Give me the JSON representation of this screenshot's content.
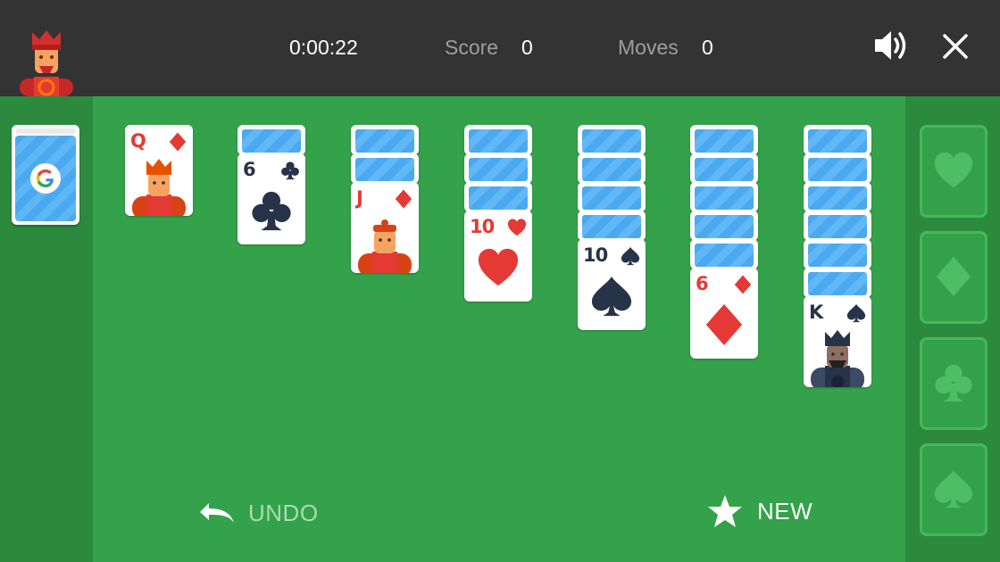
{
  "header": {
    "timer": "0:00:22",
    "score_label": "Score",
    "score_value": "0",
    "moves_label": "Moves",
    "moves_value": "0",
    "sound_icon": "speaker-icon",
    "close_icon": "close-icon"
  },
  "colors": {
    "felt": "#34a24a",
    "side_panel": "#2c8a3f",
    "top_bar": "#333333",
    "red_suit": "#e53935",
    "black_suit": "#263348",
    "card_back": "#4aa9f0"
  },
  "stock": {
    "logo": "G",
    "face_down": true
  },
  "tableau": [
    {
      "face_down_count": 0,
      "top_card": {
        "rank": "Q",
        "suit": "diamonds",
        "color": "red"
      }
    },
    {
      "face_down_count": 1,
      "top_card": {
        "rank": "6",
        "suit": "clubs",
        "color": "black"
      }
    },
    {
      "face_down_count": 2,
      "top_card": {
        "rank": "J",
        "suit": "diamonds",
        "color": "red"
      }
    },
    {
      "face_down_count": 3,
      "top_card": {
        "rank": "10",
        "suit": "hearts",
        "color": "red"
      }
    },
    {
      "face_down_count": 4,
      "top_card": {
        "rank": "10",
        "suit": "spades",
        "color": "black"
      }
    },
    {
      "face_down_count": 5,
      "top_card": {
        "rank": "6",
        "suit": "diamonds",
        "color": "red"
      }
    },
    {
      "face_down_count": 6,
      "top_card": {
        "rank": "K",
        "suit": "spades",
        "color": "black"
      }
    }
  ],
  "foundations": [
    {
      "suit": "hearts",
      "icon": "heart-icon"
    },
    {
      "suit": "diamonds",
      "icon": "diamond-icon"
    },
    {
      "suit": "clubs",
      "icon": "club-icon"
    },
    {
      "suit": "spades",
      "icon": "spade-icon"
    }
  ],
  "footer": {
    "undo_label": "UNDO",
    "new_label": "NEW"
  }
}
